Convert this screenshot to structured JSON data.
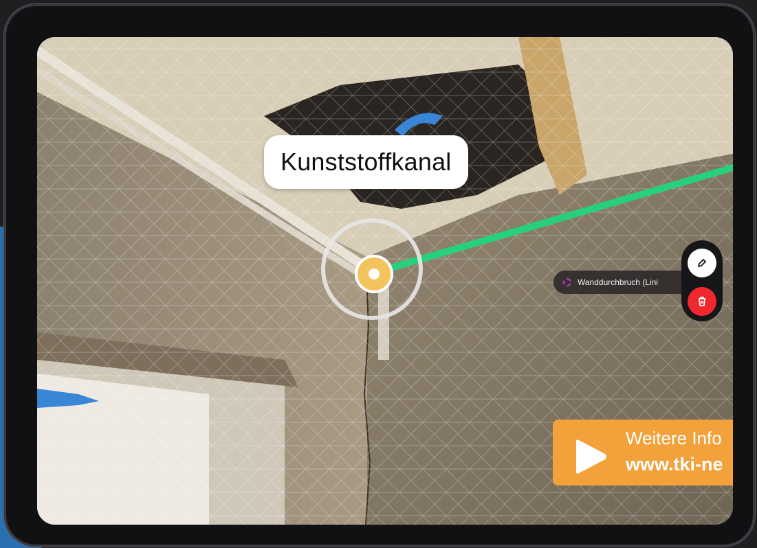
{
  "scene": {
    "object_label": "Kunststoffkanal"
  },
  "tooltip": {
    "text": "Wanddurchbruch (Lini"
  },
  "actions": {
    "edit_icon": "pencil-icon",
    "delete_icon": "trash-icon"
  },
  "promo": {
    "line1": "Weitere Info",
    "line2": "www.tki-ne",
    "icon": "play-icon"
  },
  "colors": {
    "measure_line": "#27d07c",
    "marker": "#f3c45c",
    "delete": "#f0282d",
    "promo": "#f2a13b",
    "tooltip_ring": "#c03bd0",
    "arrow": "#3a86d6"
  }
}
